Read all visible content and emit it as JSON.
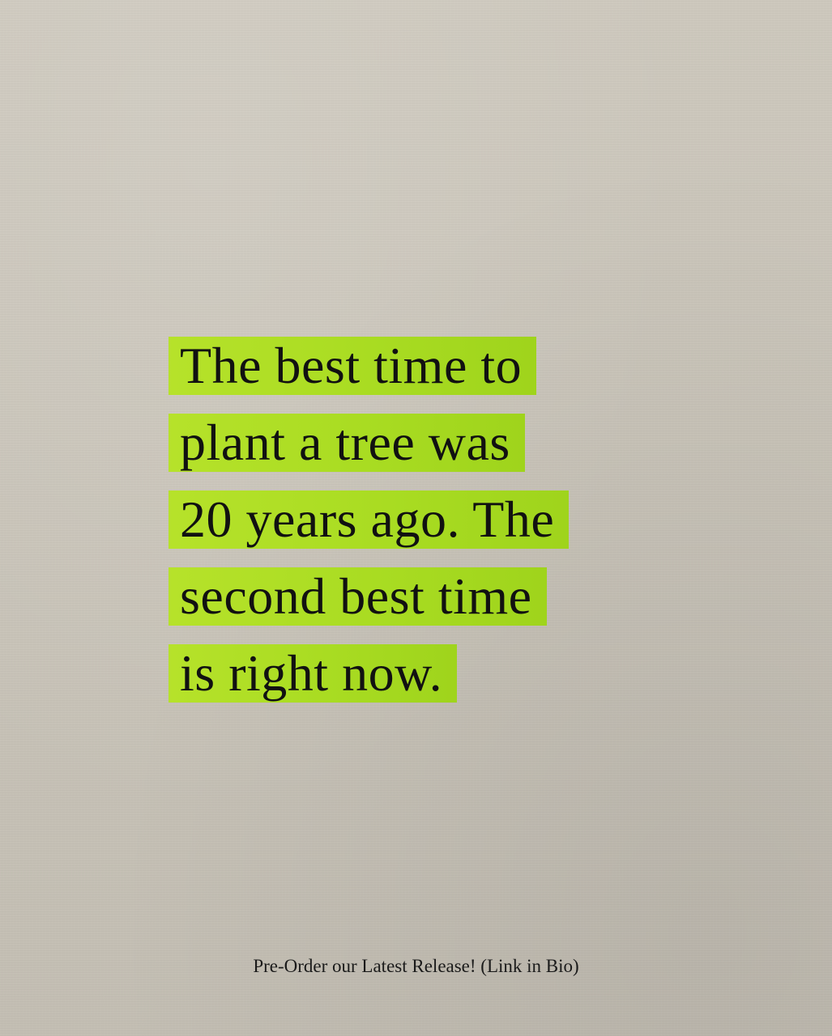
{
  "quote": {
    "lines": [
      "The best time to",
      "plant a tree was",
      "20 years ago. The",
      "second best time",
      "is right now."
    ]
  },
  "footer": {
    "text": "Pre-Order our Latest Release! (Link in Bio)"
  },
  "colors": {
    "background": "#c9c4b9",
    "highlight": "#aadc22",
    "text": "#111111"
  }
}
